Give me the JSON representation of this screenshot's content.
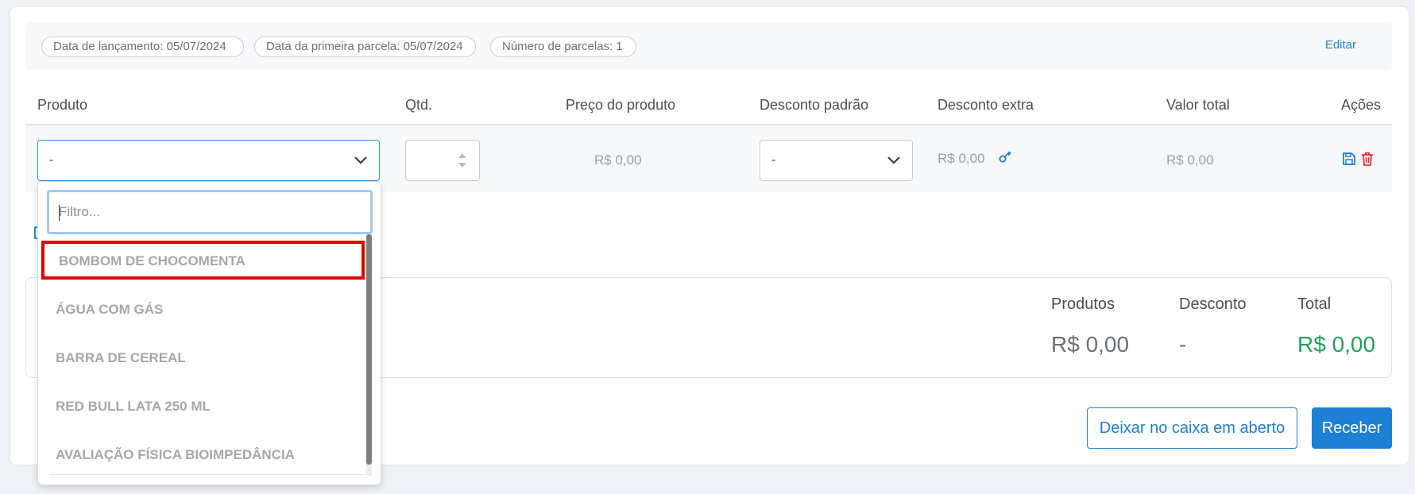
{
  "info": {
    "launch_date": "Data de lançamento: 05/07/2024",
    "first_installment": "Data da primeira parcela: 05/07/2024",
    "installments": "Número de parcelas: 1",
    "edit_label": "Editar"
  },
  "table": {
    "headers": {
      "product": "Produto",
      "qty": "Qtd.",
      "price": "Preço do produto",
      "std_discount": "Desconto padrão",
      "extra_discount": "Desconto extra",
      "total": "Valor total",
      "actions": "Ações"
    },
    "row": {
      "product_value": "-",
      "qty_value": "",
      "price": "R$ 0,00",
      "std_discount_value": "-",
      "extra_discount": "R$ 0,00",
      "total": "R$ 0,00"
    }
  },
  "dropdown": {
    "filter_placeholder": "Filtro...",
    "options": [
      "BOMBOM DE CHOCOMENTA",
      "ÁGUA COM GÁS",
      "BARRA DE CEREAL",
      "RED BULL LATA 250 ML",
      "AVALIAÇÃO FÍSICA BIOIMPEDÂNCIA"
    ],
    "highlighted_index": 0
  },
  "summary": {
    "products_label": "Produtos",
    "products_value": "R$ 0,00",
    "discount_label": "Desconto",
    "discount_value": "-",
    "total_label": "Total",
    "total_value": "R$ 0,00"
  },
  "buttons": {
    "leave_open": "Deixar no caixa em aberto",
    "receive": "Receber"
  },
  "colors": {
    "accent": "#1e7fd6",
    "total_green": "#23a05a",
    "highlight_red": "#e10000",
    "delete_red": "#e0302e"
  }
}
